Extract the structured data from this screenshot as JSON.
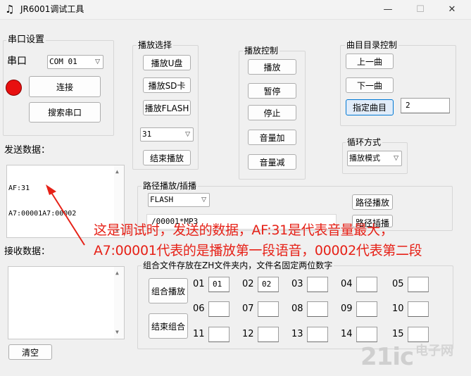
{
  "window": {
    "title": "JR6001调试工具",
    "icon": "music-note-icon",
    "controls": {
      "minimize": "—",
      "maximize": "☐",
      "close": "✕"
    }
  },
  "serial": {
    "group_label": "串口设置",
    "port_label": "串口",
    "port_value": "COM 01",
    "status_color": "#e81010",
    "connect_label": "连接",
    "search_label": "搜索串口"
  },
  "send": {
    "label": "发送数据：",
    "lines": [
      "AF:31",
      "A7:00001A7:00002"
    ]
  },
  "receive": {
    "label": "接收数据：",
    "clear_label": "清空"
  },
  "play_select": {
    "group_label": "播放选择",
    "udisk": "播放U盘",
    "sd": "播放SD卡",
    "flash": "播放FLASH",
    "volume_value": "31",
    "stop": "结束播放"
  },
  "play_control": {
    "group_label": "播放控制",
    "play": "播放",
    "pause": "暂停",
    "stop": "停止",
    "vol_up": "音量加",
    "vol_down": "音量减"
  },
  "track": {
    "group_label": "曲目目录控制",
    "prev": "上一曲",
    "next": "下一曲",
    "specify": "指定曲目",
    "number": "2"
  },
  "loop": {
    "group_label": "循环方式",
    "mode_value": "播放模式"
  },
  "path": {
    "group_label": "路径播放/插播",
    "device_value": "FLASH",
    "path_value": "/00001*MP3",
    "play_label": "路径播放",
    "insert_label": "路径插播"
  },
  "combo": {
    "group_label": "组合文件存放在ZH文件夹内，文件名固定两位数字",
    "play_label": "组合播放",
    "stop_label": "结束组合",
    "slots": [
      {
        "num": "01",
        "value": "01"
      },
      {
        "num": "02",
        "value": "02"
      },
      {
        "num": "03",
        "value": ""
      },
      {
        "num": "04",
        "value": ""
      },
      {
        "num": "05",
        "value": ""
      },
      {
        "num": "06",
        "value": ""
      },
      {
        "num": "07",
        "value": ""
      },
      {
        "num": "08",
        "value": ""
      },
      {
        "num": "09",
        "value": ""
      },
      {
        "num": "10",
        "value": ""
      },
      {
        "num": "11",
        "value": ""
      },
      {
        "num": "12",
        "value": ""
      },
      {
        "num": "13",
        "value": ""
      },
      {
        "num": "14",
        "value": ""
      },
      {
        "num": "15",
        "value": ""
      }
    ]
  },
  "annotation": {
    "line1": "这是调试时，发送的数据，AF:31是代表音量最大，",
    "line2": "A7:00001代表的是播放第一段语音，00002代表第二段",
    "arrow_color": "#e62117"
  },
  "watermark": {
    "brand": "21ic",
    "tag": "电子网"
  }
}
